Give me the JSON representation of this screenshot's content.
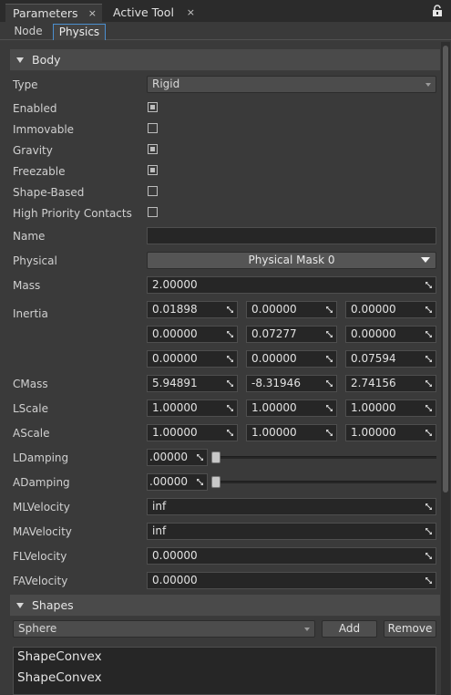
{
  "window_tabs": [
    {
      "label": "Parameters",
      "close": "×"
    },
    {
      "label": "Active Tool",
      "close": "×"
    }
  ],
  "sub_tabs": [
    "Node",
    "Physics"
  ],
  "body_section": {
    "title": "Body",
    "type": {
      "label": "Type",
      "value": "Rigid"
    },
    "flags": [
      {
        "label": "Enabled",
        "checked": true
      },
      {
        "label": "Immovable",
        "checked": false
      },
      {
        "label": "Gravity",
        "checked": true
      },
      {
        "label": "Freezable",
        "checked": true
      },
      {
        "label": "Shape-Based",
        "checked": false
      },
      {
        "label": "High Priority Contacts",
        "checked": false
      }
    ],
    "name": {
      "label": "Name",
      "value": ""
    },
    "physical": {
      "label": "Physical",
      "value": "Physical Mask 0"
    },
    "mass": {
      "label": "Mass",
      "value": "2.00000"
    },
    "inertia": {
      "label": "Inertia",
      "rows": [
        [
          "0.01898",
          "0.00000",
          "0.00000"
        ],
        [
          "0.00000",
          "0.07277",
          "0.00000"
        ],
        [
          "0.00000",
          "0.00000",
          "0.07594"
        ]
      ]
    },
    "cmass": {
      "label": "CMass",
      "values": [
        "5.94891",
        "-8.31946",
        "2.74156"
      ]
    },
    "lscale": {
      "label": "LScale",
      "values": [
        "1.00000",
        "1.00000",
        "1.00000"
      ]
    },
    "ascale": {
      "label": "AScale",
      "values": [
        "1.00000",
        "1.00000",
        "1.00000"
      ]
    },
    "ldamping": {
      "label": "LDamping",
      "value": ".00000",
      "slider": 0
    },
    "adamping": {
      "label": "ADamping",
      "value": ".00000",
      "slider": 0
    },
    "mlvelocity": {
      "label": "MLVelocity",
      "value": "inf"
    },
    "mavelocity": {
      "label": "MAVelocity",
      "value": "inf"
    },
    "flvelocity": {
      "label": "FLVelocity",
      "value": "0.00000"
    },
    "favelocity": {
      "label": "FAVelocity",
      "value": "0.00000"
    }
  },
  "shapes_section": {
    "title": "Shapes",
    "shape_type": "Sphere",
    "add_label": "Add",
    "remove_label": "Remove",
    "items": [
      "ShapeConvex",
      "ShapeConvex"
    ]
  },
  "colors": {
    "background": "#3a3a3a",
    "field": "#262626",
    "section_header": "#4a4a4a",
    "active_tab_border": "#4b8fcf"
  }
}
